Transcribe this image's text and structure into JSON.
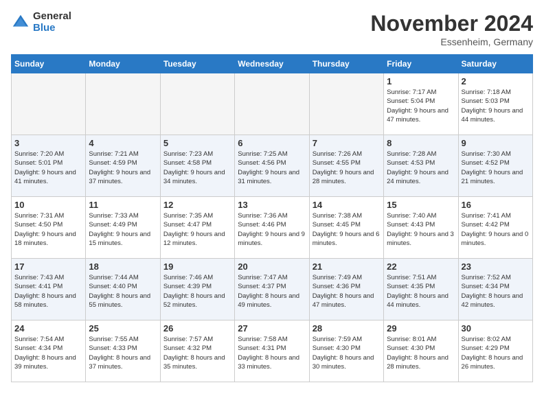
{
  "logo": {
    "general": "General",
    "blue": "Blue"
  },
  "header": {
    "month": "November 2024",
    "location": "Essenheim, Germany"
  },
  "days_of_week": [
    "Sunday",
    "Monday",
    "Tuesday",
    "Wednesday",
    "Thursday",
    "Friday",
    "Saturday"
  ],
  "weeks": [
    [
      {
        "day": "",
        "info": ""
      },
      {
        "day": "",
        "info": ""
      },
      {
        "day": "",
        "info": ""
      },
      {
        "day": "",
        "info": ""
      },
      {
        "day": "",
        "info": ""
      },
      {
        "day": "1",
        "info": "Sunrise: 7:17 AM\nSunset: 5:04 PM\nDaylight: 9 hours and 47 minutes."
      },
      {
        "day": "2",
        "info": "Sunrise: 7:18 AM\nSunset: 5:03 PM\nDaylight: 9 hours and 44 minutes."
      }
    ],
    [
      {
        "day": "3",
        "info": "Sunrise: 7:20 AM\nSunset: 5:01 PM\nDaylight: 9 hours and 41 minutes."
      },
      {
        "day": "4",
        "info": "Sunrise: 7:21 AM\nSunset: 4:59 PM\nDaylight: 9 hours and 37 minutes."
      },
      {
        "day": "5",
        "info": "Sunrise: 7:23 AM\nSunset: 4:58 PM\nDaylight: 9 hours and 34 minutes."
      },
      {
        "day": "6",
        "info": "Sunrise: 7:25 AM\nSunset: 4:56 PM\nDaylight: 9 hours and 31 minutes."
      },
      {
        "day": "7",
        "info": "Sunrise: 7:26 AM\nSunset: 4:55 PM\nDaylight: 9 hours and 28 minutes."
      },
      {
        "day": "8",
        "info": "Sunrise: 7:28 AM\nSunset: 4:53 PM\nDaylight: 9 hours and 24 minutes."
      },
      {
        "day": "9",
        "info": "Sunrise: 7:30 AM\nSunset: 4:52 PM\nDaylight: 9 hours and 21 minutes."
      }
    ],
    [
      {
        "day": "10",
        "info": "Sunrise: 7:31 AM\nSunset: 4:50 PM\nDaylight: 9 hours and 18 minutes."
      },
      {
        "day": "11",
        "info": "Sunrise: 7:33 AM\nSunset: 4:49 PM\nDaylight: 9 hours and 15 minutes."
      },
      {
        "day": "12",
        "info": "Sunrise: 7:35 AM\nSunset: 4:47 PM\nDaylight: 9 hours and 12 minutes."
      },
      {
        "day": "13",
        "info": "Sunrise: 7:36 AM\nSunset: 4:46 PM\nDaylight: 9 hours and 9 minutes."
      },
      {
        "day": "14",
        "info": "Sunrise: 7:38 AM\nSunset: 4:45 PM\nDaylight: 9 hours and 6 minutes."
      },
      {
        "day": "15",
        "info": "Sunrise: 7:40 AM\nSunset: 4:43 PM\nDaylight: 9 hours and 3 minutes."
      },
      {
        "day": "16",
        "info": "Sunrise: 7:41 AM\nSunset: 4:42 PM\nDaylight: 9 hours and 0 minutes."
      }
    ],
    [
      {
        "day": "17",
        "info": "Sunrise: 7:43 AM\nSunset: 4:41 PM\nDaylight: 8 hours and 58 minutes."
      },
      {
        "day": "18",
        "info": "Sunrise: 7:44 AM\nSunset: 4:40 PM\nDaylight: 8 hours and 55 minutes."
      },
      {
        "day": "19",
        "info": "Sunrise: 7:46 AM\nSunset: 4:39 PM\nDaylight: 8 hours and 52 minutes."
      },
      {
        "day": "20",
        "info": "Sunrise: 7:47 AM\nSunset: 4:37 PM\nDaylight: 8 hours and 49 minutes."
      },
      {
        "day": "21",
        "info": "Sunrise: 7:49 AM\nSunset: 4:36 PM\nDaylight: 8 hours and 47 minutes."
      },
      {
        "day": "22",
        "info": "Sunrise: 7:51 AM\nSunset: 4:35 PM\nDaylight: 8 hours and 44 minutes."
      },
      {
        "day": "23",
        "info": "Sunrise: 7:52 AM\nSunset: 4:34 PM\nDaylight: 8 hours and 42 minutes."
      }
    ],
    [
      {
        "day": "24",
        "info": "Sunrise: 7:54 AM\nSunset: 4:34 PM\nDaylight: 8 hours and 39 minutes."
      },
      {
        "day": "25",
        "info": "Sunrise: 7:55 AM\nSunset: 4:33 PM\nDaylight: 8 hours and 37 minutes."
      },
      {
        "day": "26",
        "info": "Sunrise: 7:57 AM\nSunset: 4:32 PM\nDaylight: 8 hours and 35 minutes."
      },
      {
        "day": "27",
        "info": "Sunrise: 7:58 AM\nSunset: 4:31 PM\nDaylight: 8 hours and 33 minutes."
      },
      {
        "day": "28",
        "info": "Sunrise: 7:59 AM\nSunset: 4:30 PM\nDaylight: 8 hours and 30 minutes."
      },
      {
        "day": "29",
        "info": "Sunrise: 8:01 AM\nSunset: 4:30 PM\nDaylight: 8 hours and 28 minutes."
      },
      {
        "day": "30",
        "info": "Sunrise: 8:02 AM\nSunset: 4:29 PM\nDaylight: 8 hours and 26 minutes."
      }
    ]
  ]
}
